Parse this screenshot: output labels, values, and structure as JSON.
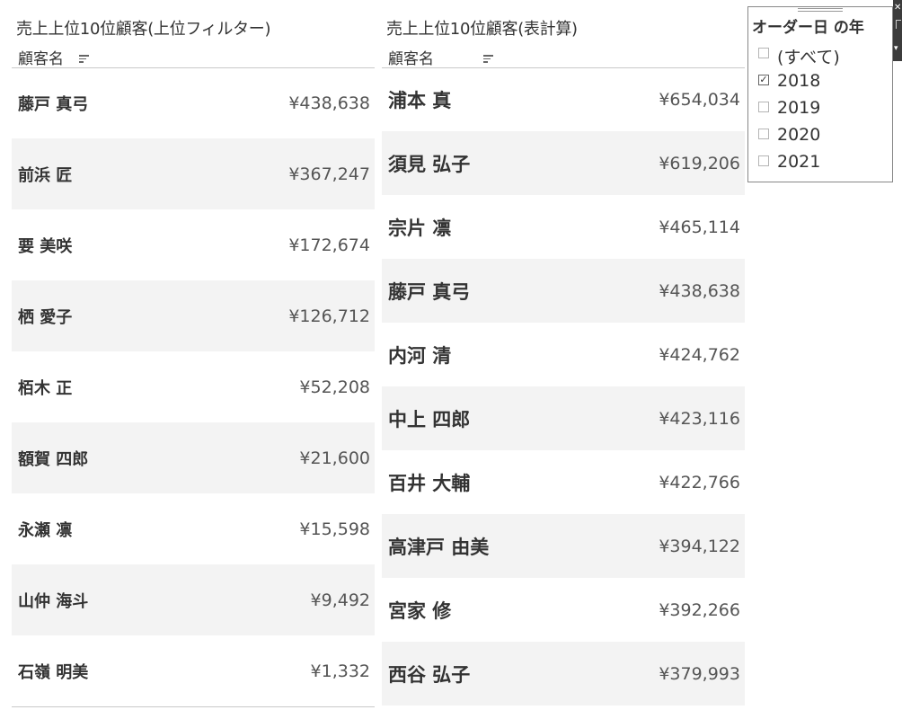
{
  "left_panel": {
    "title": "売上上位10位顧客(上位フィルター)",
    "column_header": "顧客名",
    "rows": [
      {
        "name": "藤戸 真弓",
        "value": "¥438,638"
      },
      {
        "name": "前浜 匠",
        "value": "¥367,247"
      },
      {
        "name": "要 美咲",
        "value": "¥172,674"
      },
      {
        "name": "栖 愛子",
        "value": "¥126,712"
      },
      {
        "name": "栢木 正",
        "value": "¥52,208"
      },
      {
        "name": "額賀 四郎",
        "value": "¥21,600"
      },
      {
        "name": "永瀬 凛",
        "value": "¥15,598"
      },
      {
        "name": "山仲 海斗",
        "value": "¥9,492"
      },
      {
        "name": "石嶺 明美",
        "value": "¥1,332"
      }
    ]
  },
  "right_panel": {
    "title": "売上上位10位顧客(表計算)",
    "column_header": "顧客名",
    "rows": [
      {
        "name": "浦本 真",
        "value": "¥654,034"
      },
      {
        "name": "須見 弘子",
        "value": "¥619,206"
      },
      {
        "name": "宗片 凛",
        "value": "¥465,114"
      },
      {
        "name": "藤戸 真弓",
        "value": "¥438,638"
      },
      {
        "name": "内河 清",
        "value": "¥424,762"
      },
      {
        "name": "中上 四郎",
        "value": "¥423,116"
      },
      {
        "name": "百井 大輔",
        "value": "¥422,766"
      },
      {
        "name": "高津戸 由美",
        "value": "¥394,122"
      },
      {
        "name": "宮家 修",
        "value": "¥392,266"
      },
      {
        "name": "西谷 弘子",
        "value": "¥379,993"
      }
    ]
  },
  "filter": {
    "title": "オーダー日 の年",
    "options": [
      {
        "label": "(すべて)",
        "checked": false
      },
      {
        "label": "2018",
        "checked": true
      },
      {
        "label": "2019",
        "checked": false
      },
      {
        "label": "2020",
        "checked": false
      },
      {
        "label": "2021",
        "checked": false
      }
    ]
  },
  "icons": {
    "sort": "sort-descending-icon",
    "checkbox_checked": "check-icon",
    "close": "close-icon",
    "chevron": "chevron-down-icon"
  },
  "colors": {
    "row_alt_background": "#f3f3f3",
    "text": "#333333",
    "value_text": "#555555"
  }
}
